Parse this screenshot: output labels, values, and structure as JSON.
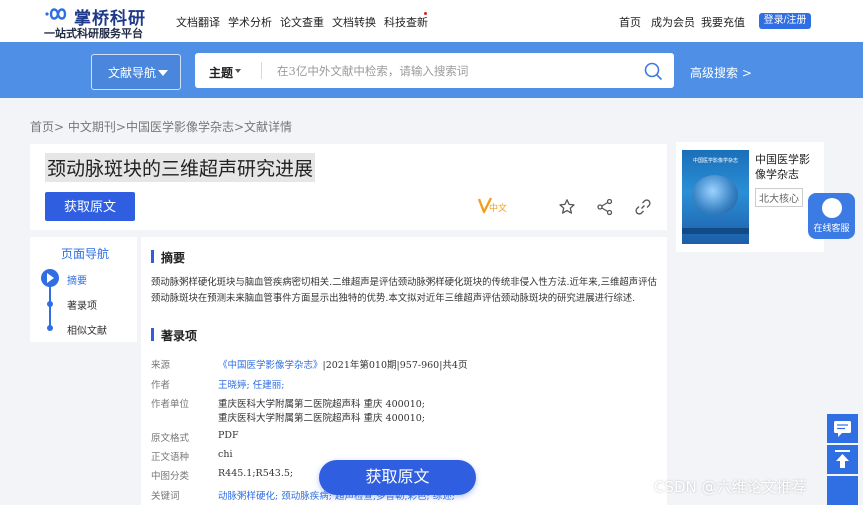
{
  "header": {
    "logo_name": "掌桥科研",
    "logo_tagline": "一站式科研服务平台",
    "nav": [
      "文档翻译",
      "学术分析",
      "论文查重",
      "文档转换",
      "科技查新"
    ],
    "right_nav": [
      "首页",
      "成为会员",
      "我要充值"
    ],
    "login_label": "登录/注册"
  },
  "search": {
    "nav_dropdown": "文献导航",
    "field_selector": "主题",
    "placeholder": "在3亿中外文献中检索，请输入搜索词",
    "advanced": "高级搜索 >"
  },
  "breadcrumb": [
    "首页>",
    "中文期刊>",
    "中国医学影像学杂志>",
    "文献详情"
  ],
  "article": {
    "title": "颈动脉斑块的三维超声研究进展",
    "get_button": "获取原文",
    "lang_badge": "中文"
  },
  "journal_card": {
    "cover_title": "中国医学影像学杂志",
    "name": "中国医学影像学杂志",
    "tag": "北大核心"
  },
  "service": {
    "label": "在线客服"
  },
  "page_nav": {
    "title": "页面导航",
    "items": [
      "摘要",
      "著录项",
      "相似文献"
    ]
  },
  "abstract": {
    "heading": "摘要",
    "text": "颈动脉粥样硬化斑块与脑血管疾病密切相关.二维超声是评估颈动脉粥样硬化斑块的传统非侵入性方法.近年来,三维超声评估颈动脉斑块在预测未来脑血管事件方面显示出独特的优势.本文拟对近年三维超声评估颈动脉斑块的研究进展进行综述."
  },
  "record": {
    "heading": "著录项",
    "source_label": "来源",
    "source_journal": "《中国医学影像学杂志》",
    "source_detail": "|2021年第010期|957-960|共4页",
    "author_label": "作者",
    "authors": "王晓婷; 任建丽;",
    "org_label": "作者单位",
    "org_lines": [
      "重庆医科大学附属第二医院超声科 重庆 400010;",
      "重庆医科大学附属第二医院超声科 重庆 400010;"
    ],
    "format_label": "原文格式",
    "format": "PDF",
    "lang_label": "正文语种",
    "lang": "chi",
    "class_label": "中图分类",
    "class": "R445.1;R543.5;",
    "kw_label": "关键词",
    "keywords": "动脉粥样硬化;   颈动脉疾病;   超声检查,多普勒,彩色;   综述;"
  },
  "float_button": "获取原文",
  "watermark": "CSDN @六维论文推荐"
}
